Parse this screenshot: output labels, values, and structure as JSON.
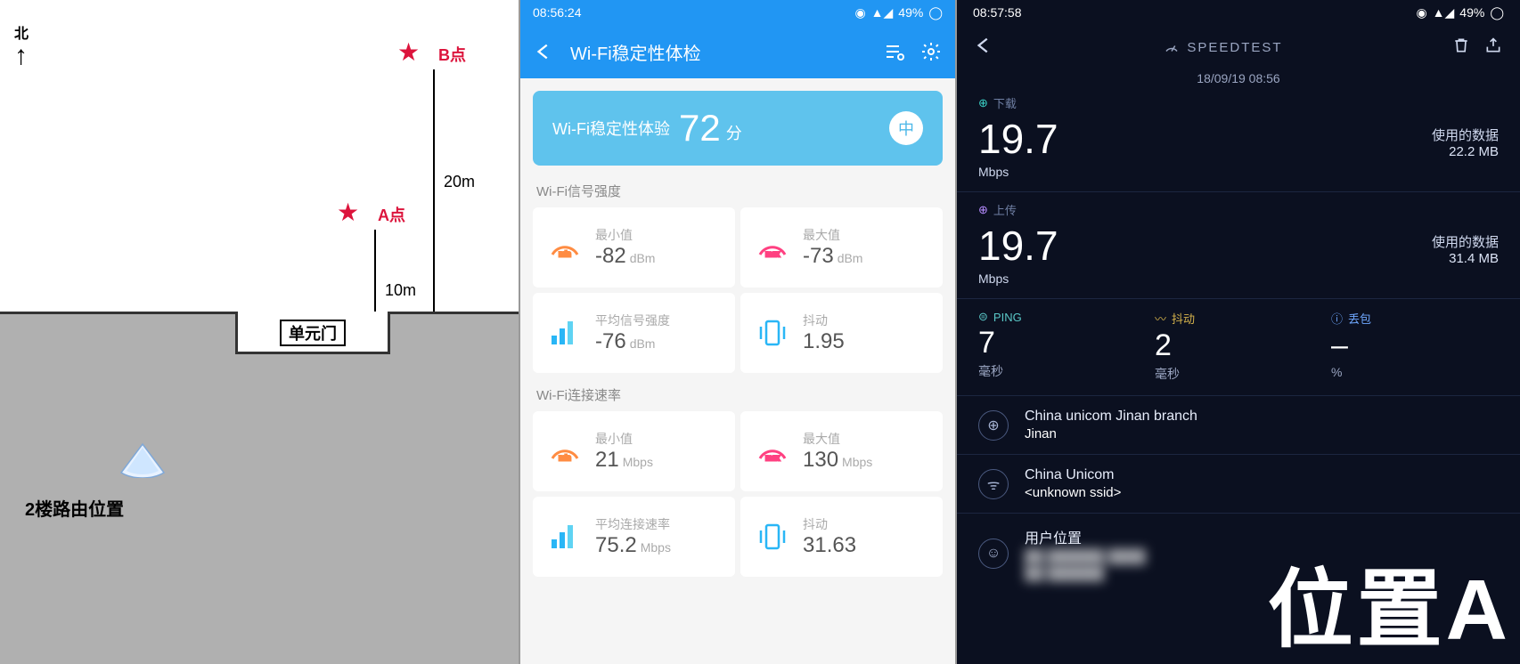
{
  "floorplan": {
    "north_label": "北",
    "point_a": "A点",
    "point_b": "B点",
    "dist_a": "10m",
    "dist_b": "20m",
    "door_label": "单元门",
    "router_label": "2楼路由位置"
  },
  "wifi": {
    "status_time": "08:56:24",
    "status_battery": "49%",
    "appbar_title": "Wi-Fi稳定性体检",
    "score_label": "Wi-Fi稳定性体验",
    "score_value": "72",
    "score_unit": "分",
    "score_badge": "中",
    "section_signal": "Wi-Fi信号强度",
    "section_speed": "Wi-Fi连接速率",
    "metrics_signal": {
      "min": {
        "label": "最小值",
        "value": "-82",
        "unit": "dBm"
      },
      "max": {
        "label": "最大值",
        "value": "-73",
        "unit": "dBm"
      },
      "avg": {
        "label": "平均信号强度",
        "value": "-76",
        "unit": "dBm"
      },
      "jitter": {
        "label": "抖动",
        "value": "1.95",
        "unit": ""
      }
    },
    "metrics_speed": {
      "min": {
        "label": "最小值",
        "value": "21",
        "unit": "Mbps"
      },
      "max": {
        "label": "最大值",
        "value": "130",
        "unit": "Mbps"
      },
      "avg": {
        "label": "平均连接速率",
        "value": "75.2",
        "unit": "Mbps"
      },
      "jitter": {
        "label": "抖动",
        "value": "31.63",
        "unit": ""
      }
    }
  },
  "speedtest": {
    "status_time": "08:57:58",
    "status_battery": "49%",
    "title": "SPEEDTEST",
    "date": "18/09/19 08:56",
    "download": {
      "label": "下载",
      "value": "19.7",
      "unit": "Mbps",
      "usage_label": "使用的数据",
      "usage_value": "22.2 MB"
    },
    "upload": {
      "label": "上传",
      "value": "19.7",
      "unit": "Mbps",
      "usage_label": "使用的数据",
      "usage_value": "31.4 MB"
    },
    "ping": {
      "label": "PING",
      "value": "7",
      "unit": "毫秒"
    },
    "jitter": {
      "label": "抖动",
      "value": "2",
      "unit": "毫秒"
    },
    "loss": {
      "label": "丢包",
      "value": "–",
      "unit": "%"
    },
    "isp": {
      "name": "China unicom Jinan branch",
      "city": "Jinan"
    },
    "network": {
      "name": "China Unicom",
      "ssid": "<unknown ssid>"
    },
    "user_location_label": "用户位置"
  },
  "overlay": "位置A"
}
